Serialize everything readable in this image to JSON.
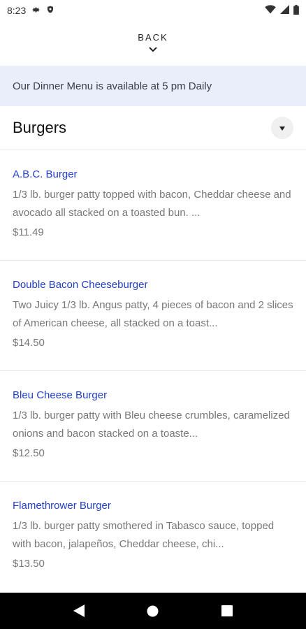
{
  "status_bar": {
    "time": "8:23",
    "icons_left": [
      "gear-icon",
      "shield-icon"
    ],
    "icons_right": [
      "wifi-icon",
      "signal-icon",
      "battery-icon"
    ]
  },
  "header": {
    "back_label": "BACK"
  },
  "banner": {
    "text": "Our Dinner Menu is available at 5 pm Daily"
  },
  "section": {
    "title": "Burgers",
    "items": [
      {
        "name": "A.B.C. Burger",
        "description": "1/3 lb. burger patty topped with bacon, Cheddar cheese and avocado all stacked on a toasted bun. ...",
        "price": "$11.49"
      },
      {
        "name": "Double Bacon Cheeseburger",
        "description": "Two Juicy 1/3 lb. Angus patty, 4 pieces of bacon and 2 slices of American cheese, all stacked on a toast...",
        "price": "$14.50"
      },
      {
        "name": "Bleu Cheese Burger",
        "description": "1/3 lb. burger patty with Bleu cheese  crumbles, caramelized onions and bacon stacked on a toaste...",
        "price": "$12.50"
      },
      {
        "name": "Flamethrower Burger",
        "description": "1/3 lb. burger patty smothered in Tabasco sauce, topped with bacon, jalapeños, Cheddar cheese, chi...",
        "price": "$13.50"
      }
    ]
  },
  "colors": {
    "banner_bg": "#e9eefa",
    "item_name": "#2340c6",
    "nav_bar": "#000000"
  }
}
